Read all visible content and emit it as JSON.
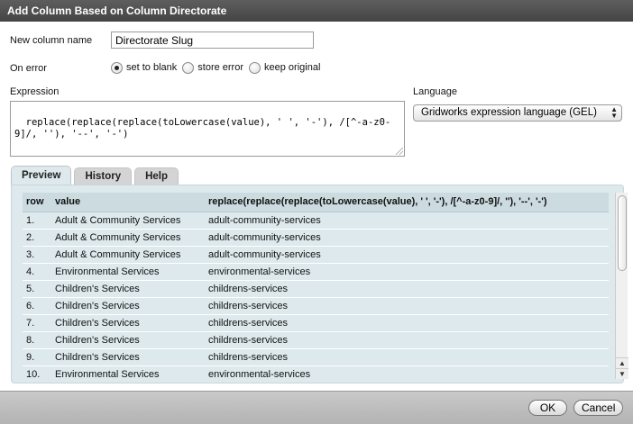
{
  "dialog": {
    "title": "Add Column Based on Column Directorate"
  },
  "form": {
    "new_column_label": "New column name",
    "new_column_value": "Directorate Slug",
    "on_error_label": "On error",
    "on_error_options": [
      "set to blank",
      "store error",
      "keep original"
    ],
    "on_error_selected": 0,
    "expression_label": "Expression",
    "expression_value": "replace(replace(replace(toLowercase(value), ' ', '-'), /[^-a-z0-9]/, ''), '--', '-')",
    "language_label": "Language",
    "language_value": "Gridworks expression language (GEL)"
  },
  "tabs": [
    {
      "label": "Preview",
      "active": true
    },
    {
      "label": "History",
      "active": false
    },
    {
      "label": "Help",
      "active": false
    }
  ],
  "preview": {
    "headers": [
      "row",
      "value",
      "replace(replace(replace(toLowercase(value), ' ', '-'), /[^-a-z0-9]/, ''), '--', '-')"
    ],
    "rows": [
      [
        "1.",
        "Adult & Community Services",
        "adult-community-services"
      ],
      [
        "2.",
        "Adult & Community Services",
        "adult-community-services"
      ],
      [
        "3.",
        "Adult & Community Services",
        "adult-community-services"
      ],
      [
        "4.",
        "Environmental Services",
        "environmental-services"
      ],
      [
        "5.",
        "Children's Services",
        "childrens-services"
      ],
      [
        "6.",
        "Children's Services",
        "childrens-services"
      ],
      [
        "7.",
        "Children's Services",
        "childrens-services"
      ],
      [
        "8.",
        "Children's Services",
        "childrens-services"
      ],
      [
        "9.",
        "Children's Services",
        "childrens-services"
      ],
      [
        "10.",
        "Environmental Services",
        "environmental-services"
      ]
    ]
  },
  "buttons": {
    "ok": "OK",
    "cancel": "Cancel"
  },
  "icons": {
    "select_arrows": "updown-arrows-icon",
    "scroll_up": "scroll-up-icon",
    "scroll_down": "scroll-down-icon"
  }
}
